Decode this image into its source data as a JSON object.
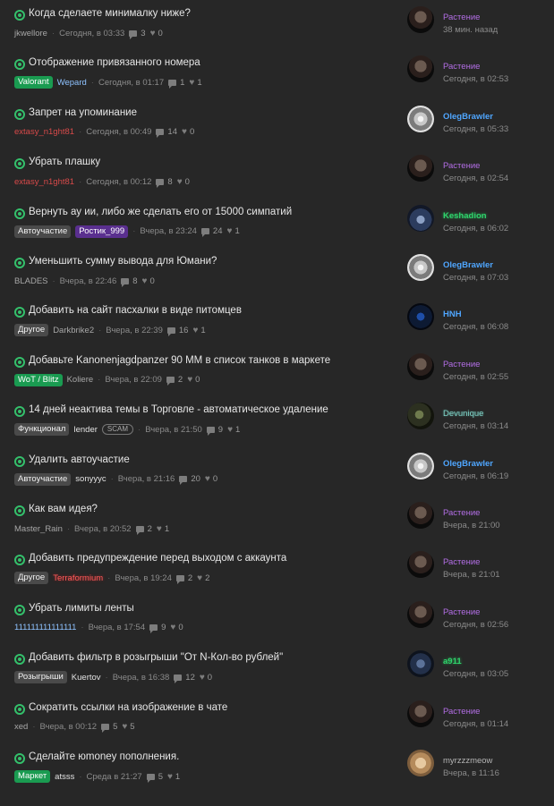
{
  "threads": [
    {
      "title": "Когда сделаете минималку ниже?",
      "prefix": "",
      "prefix_style": "",
      "author": "jkwellore",
      "author_style": "",
      "scam": "",
      "time": "Сегодня, в 03:33",
      "replies": "3",
      "likes": "0",
      "last_poster": "Растение",
      "last_style": "rast",
      "avatar": "a-rast",
      "last_time": "38 мин. назад"
    },
    {
      "title": "Отображение привязанного номера",
      "prefix": "Valorant",
      "prefix_style": "green",
      "author": "Wepard",
      "author_style": "blue",
      "scam": "",
      "time": "Сегодня, в 01:17",
      "replies": "1",
      "likes": "1",
      "last_poster": "Растение",
      "last_style": "rast",
      "avatar": "a-rast",
      "last_time": "Сегодня, в 02:53"
    },
    {
      "title": "Запрет на упоминание",
      "prefix": "",
      "prefix_style": "",
      "author": "extasy_n1ght81",
      "author_style": "red",
      "scam": "",
      "time": "Сегодня, в 00:49",
      "replies": "14",
      "likes": "0",
      "last_poster": "OlegBrawler",
      "last_style": "oleg",
      "avatar": "a-oleg",
      "last_time": "Сегодня, в 05:33"
    },
    {
      "title": "Убрать плашку",
      "prefix": "",
      "prefix_style": "",
      "author": "extasy_n1ght81",
      "author_style": "red",
      "scam": "",
      "time": "Сегодня, в 00:12",
      "replies": "8",
      "likes": "0",
      "last_poster": "Растение",
      "last_style": "rast",
      "avatar": "a-rast",
      "last_time": "Сегодня, в 02:54"
    },
    {
      "title": "Вернуть ау ии, либо же сделать его от 15000 симпатий",
      "prefix": "Автоучастие",
      "prefix_style": "",
      "author": "Ростик_999",
      "author_style": "purple-tag",
      "scam": "",
      "time": "Вчера, в 23:24",
      "replies": "24",
      "likes": "1",
      "last_poster": "Keshadion",
      "last_style": "kesh",
      "avatar": "a-kesh",
      "last_time": "Сегодня, в 06:02"
    },
    {
      "title": "Уменьшить сумму вывода для Юмани?",
      "prefix": "",
      "prefix_style": "",
      "author": "BLADES",
      "author_style": "",
      "scam": "",
      "time": "Вчера, в 22:46",
      "replies": "8",
      "likes": "0",
      "last_poster": "OlegBrawler",
      "last_style": "oleg",
      "avatar": "a-oleg",
      "last_time": "Сегодня, в 07:03"
    },
    {
      "title": "Добавить на сайт пасхалки в виде питомцев",
      "prefix": "Другое",
      "prefix_style": "",
      "author": "Darkbrike2",
      "author_style": "",
      "scam": "",
      "time": "Вчера, в 22:39",
      "replies": "16",
      "likes": "1",
      "last_poster": "HNH",
      "last_style": "hnh",
      "avatar": "a-hnh",
      "last_time": "Сегодня, в 06:08"
    },
    {
      "title": "Добавьте Kanonenjagdpanzer 90 MM в список танков в маркете",
      "prefix": "WoT / Blitz",
      "prefix_style": "green",
      "author": "Koliere",
      "author_style": "",
      "scam": "",
      "time": "Вчера, в 22:09",
      "replies": "2",
      "likes": "0",
      "last_poster": "Растение",
      "last_style": "rast",
      "avatar": "a-rast",
      "last_time": "Сегодня, в 02:55"
    },
    {
      "title": "14 дней неактива темы в Торговле - автоматическое удаление",
      "prefix": "Функционал",
      "prefix_style": "",
      "author": "lender",
      "author_style": "white",
      "scam": "SCAM",
      "time": "Вчера, в 21:50",
      "replies": "9",
      "likes": "1",
      "last_poster": "Devunique",
      "last_style": "devu",
      "avatar": "a-devu",
      "last_time": "Сегодня, в 03:14"
    },
    {
      "title": "Удалить автоучастие",
      "prefix": "Автоучастие",
      "prefix_style": "",
      "author": "sonyyyc",
      "author_style": "white",
      "scam": "",
      "time": "Вчера, в 21:16",
      "replies": "20",
      "likes": "0",
      "last_poster": "OlegBrawler",
      "last_style": "oleg",
      "avatar": "a-oleg",
      "last_time": "Сегодня, в 06:19"
    },
    {
      "title": "Как вам идея?",
      "prefix": "",
      "prefix_style": "",
      "author": "Master_Rain",
      "author_style": "",
      "scam": "",
      "time": "Вчера, в 20:52",
      "replies": "2",
      "likes": "1",
      "last_poster": "Растение",
      "last_style": "rast",
      "avatar": "a-rast",
      "last_time": "Вчера, в 21:00"
    },
    {
      "title": "Добавить предупреждение перед выходом с аккаунта",
      "prefix": "Другое",
      "prefix_style": "",
      "author": "Terraformium",
      "author_style": "terra",
      "scam": "",
      "time": "Вчера, в 19:24",
      "replies": "2",
      "likes": "2",
      "last_poster": "Растение",
      "last_style": "rast",
      "avatar": "a-rast",
      "last_time": "Вчера, в 21:01"
    },
    {
      "title": "Убрать лимиты ленты",
      "prefix": "",
      "prefix_style": "",
      "author": "111111111111111",
      "author_style": "blue",
      "scam": "",
      "time": "Вчера, в 17:54",
      "replies": "9",
      "likes": "0",
      "last_poster": "Растение",
      "last_style": "rast",
      "avatar": "a-rast",
      "last_time": "Сегодня, в 02:56"
    },
    {
      "title": "Добавить фильтр в розыгрыши \"От N-Кол-во рублей\"",
      "prefix": "Розыгрыши",
      "prefix_style": "",
      "author": "Kuertov",
      "author_style": "white",
      "scam": "",
      "time": "Вчера, в 16:38",
      "replies": "12",
      "likes": "0",
      "last_poster": "a911",
      "last_style": "a911",
      "avatar": "a-a911",
      "last_time": "Сегодня, в 03:05"
    },
    {
      "title": "Сократить ссылки на изображение в чате",
      "prefix": "",
      "prefix_style": "",
      "author": "xed",
      "author_style": "",
      "scam": "",
      "time": "Вчера, в 00:12",
      "replies": "5",
      "likes": "5",
      "last_poster": "Растение",
      "last_style": "rast",
      "avatar": "a-rast",
      "last_time": "Сегодня, в 01:14"
    },
    {
      "title": "Сделайте юmoney пополнения.",
      "prefix": "Маркет",
      "prefix_style": "green",
      "author": "atsss",
      "author_style": "white",
      "scam": "",
      "time": "Среда в 21:27",
      "replies": "5",
      "likes": "1",
      "last_poster": "myrzzzmeow",
      "last_style": "myr",
      "avatar": "a-myr",
      "last_time": "Вчера, в 11:16"
    }
  ],
  "colors": {
    "background": "#272727",
    "accent": "#34c06b",
    "last_poster_purple": "#b36ee6",
    "last_poster_blue": "#4fa6ff"
  }
}
